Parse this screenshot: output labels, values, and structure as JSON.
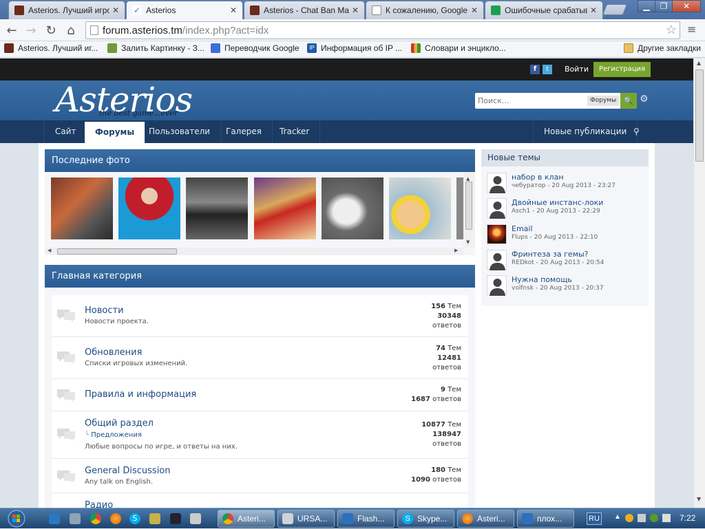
{
  "browser": {
    "tabs": [
      {
        "title": "Asterios. Лучший игро",
        "active": false
      },
      {
        "title": "Asterios",
        "active": true
      },
      {
        "title": "Asterios - Chat Ban Ma",
        "active": false
      },
      {
        "title": "К сожалению, Google",
        "active": false
      },
      {
        "title": "Ошибочные срабатыв",
        "active": false
      }
    ],
    "address": {
      "host": "forum.asterios.tm",
      "path": "/index.php?act=idx"
    },
    "bookmarks": [
      {
        "label": "Asterios. Лучший иг..."
      },
      {
        "label": "Залить Картинку - З..."
      },
      {
        "label": "Переводчик Google"
      },
      {
        "label": "Информация об IP ..."
      },
      {
        "label": "Словари и энцикло..."
      }
    ],
    "other_bookmarks": "Другие закладки"
  },
  "site": {
    "userbar": {
      "login": "Войти",
      "register": "Регистрация"
    },
    "logo": "Asterios",
    "tagline": "the best game...ever",
    "search": {
      "placeholder": "Поиск...",
      "scope": "Форумы"
    },
    "nav": [
      {
        "label": "Сайт"
      },
      {
        "label": "Форумы",
        "active": true
      },
      {
        "label": "Пользователи"
      },
      {
        "label": "Галерея"
      },
      {
        "label": "Tracker"
      }
    ],
    "nav_right": "Новые публикации"
  },
  "photos": {
    "title": "Последние фото"
  },
  "category": {
    "title": "Главная категория",
    "forums": [
      {
        "name": "Новости",
        "desc": "Новости проекта.",
        "topics": "156",
        "topics_label": "Тем",
        "replies": "30348",
        "replies_label": "ответов"
      },
      {
        "name": "Обновления",
        "desc": "Списки игровых изменений.",
        "topics": "74",
        "topics_label": "Тем",
        "replies": "12481",
        "replies_label": "ответов"
      },
      {
        "name": "Правила и информация",
        "desc": "",
        "topics": "9",
        "topics_label": "Тем",
        "replies": "1687",
        "replies_label": "ответов"
      },
      {
        "name": "Общий раздел",
        "sub": "Предложения",
        "desc": "Любые вопросы по игре, и ответы на них.",
        "topics": "10877",
        "topics_label": "Тем",
        "replies": "138947",
        "replies_label": "ответов"
      },
      {
        "name": "General Discussion",
        "desc": "Any talk on English.",
        "topics": "180",
        "topics_label": "Тем",
        "replies": "1090",
        "replies_label": "ответов"
      },
      {
        "name": "Радио",
        "desc": ""
      }
    ]
  },
  "sidebar": {
    "title": "Новые темы",
    "topics": [
      {
        "title": "набор в клан",
        "meta": "чебуратор - 20 Aug 2013 - 23:27"
      },
      {
        "title": "Двойные инстанс-локи",
        "meta": "Asch1 - 20 Aug 2013 - 22:29"
      },
      {
        "title": "Email",
        "meta": "Flups - 20 Aug 2013 - 22:10"
      },
      {
        "title": "Фринтеза за гемы?",
        "meta": "REDkot - 20 Aug 2013 - 20:54"
      },
      {
        "title": "Нужна помощь",
        "meta": "volfnsk - 20 Aug 2013 - 20:37"
      }
    ]
  },
  "taskbar": {
    "buttons": [
      {
        "label": "Asteri..."
      },
      {
        "label": "URSA..."
      },
      {
        "label": "Flash..."
      },
      {
        "label": "Skype..."
      },
      {
        "label": "Asteri..."
      },
      {
        "label": "плох..."
      }
    ],
    "lang": "RU",
    "clock": "7:22"
  },
  "colors": {
    "header_blue": "#2f6299",
    "nav_dark": "#1b3b62",
    "register_green": "#78a52f",
    "link_blue": "#1d4c82"
  }
}
